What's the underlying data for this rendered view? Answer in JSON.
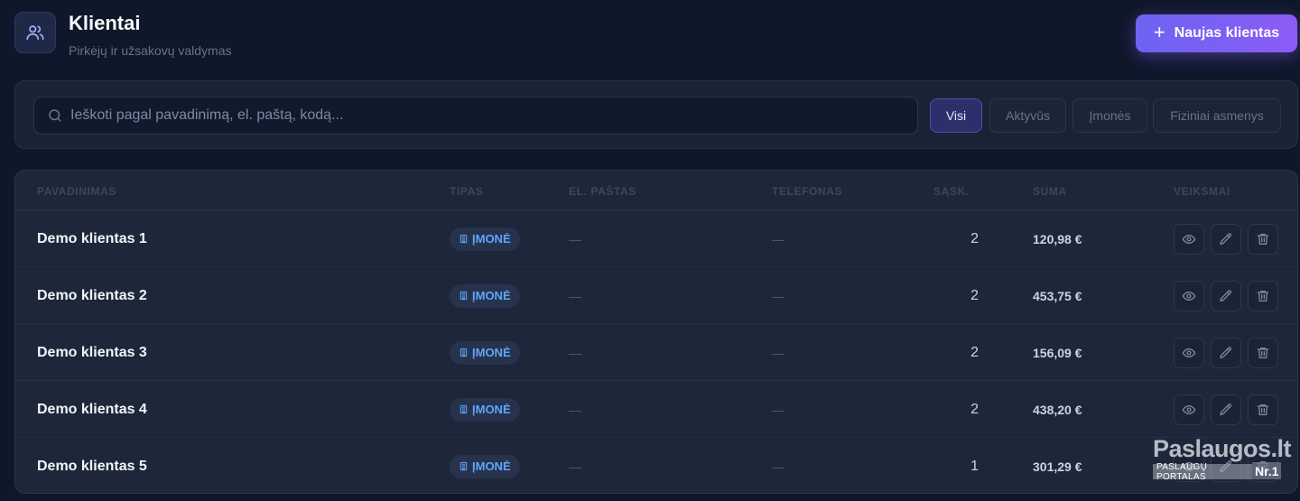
{
  "header": {
    "title": "Klientai",
    "subtitle": "Pirkėjų ir užsakovų valdymas",
    "new_button_label": "Naujas klientas",
    "icon": "users-icon"
  },
  "search": {
    "placeholder": "Ieškoti pagal pavadinimą, el. paštą, kodą...",
    "value": ""
  },
  "filters": [
    {
      "label": "Visi",
      "active": true
    },
    {
      "label": "Aktyvūs",
      "active": false
    },
    {
      "label": "Įmonės",
      "active": false
    },
    {
      "label": "Fiziniai asmenys",
      "active": false
    }
  ],
  "table": {
    "columns": {
      "name": "PAVADINIMAS",
      "type": "TIPAS",
      "email": "EL. PAŠTAS",
      "phone": "TELEFONAS",
      "invoices": "SĄSK.",
      "sum": "SUMA",
      "actions": "VEIKSMAI"
    },
    "rows": [
      {
        "name": "Demo klientas 1",
        "type": "ĮMONĖ",
        "email": "—",
        "phone": "—",
        "invoices": "2",
        "sum": "120,98 €"
      },
      {
        "name": "Demo klientas 2",
        "type": "ĮMONĖ",
        "email": "—",
        "phone": "—",
        "invoices": "2",
        "sum": "453,75 €"
      },
      {
        "name": "Demo klientas 3",
        "type": "ĮMONĖ",
        "email": "—",
        "phone": "—",
        "invoices": "2",
        "sum": "156,09 €"
      },
      {
        "name": "Demo klientas 4",
        "type": "ĮMONĖ",
        "email": "—",
        "phone": "—",
        "invoices": "2",
        "sum": "438,20 €"
      },
      {
        "name": "Demo klientas 5",
        "type": "ĮMONĖ",
        "email": "—",
        "phone": "—",
        "invoices": "1",
        "sum": "301,29 €"
      }
    ],
    "row_actions": [
      "eye-icon",
      "pencil-icon",
      "trash-icon"
    ]
  },
  "watermark": {
    "brand": "Paslaugos.lt",
    "tagline": "PASLAUGŲ PORTALAS",
    "badge": "Nr.1"
  },
  "colors": {
    "background": "#0f172a",
    "card": "#1d2739",
    "accent": "#7c5cf6",
    "badge_text": "#60a5fa"
  }
}
